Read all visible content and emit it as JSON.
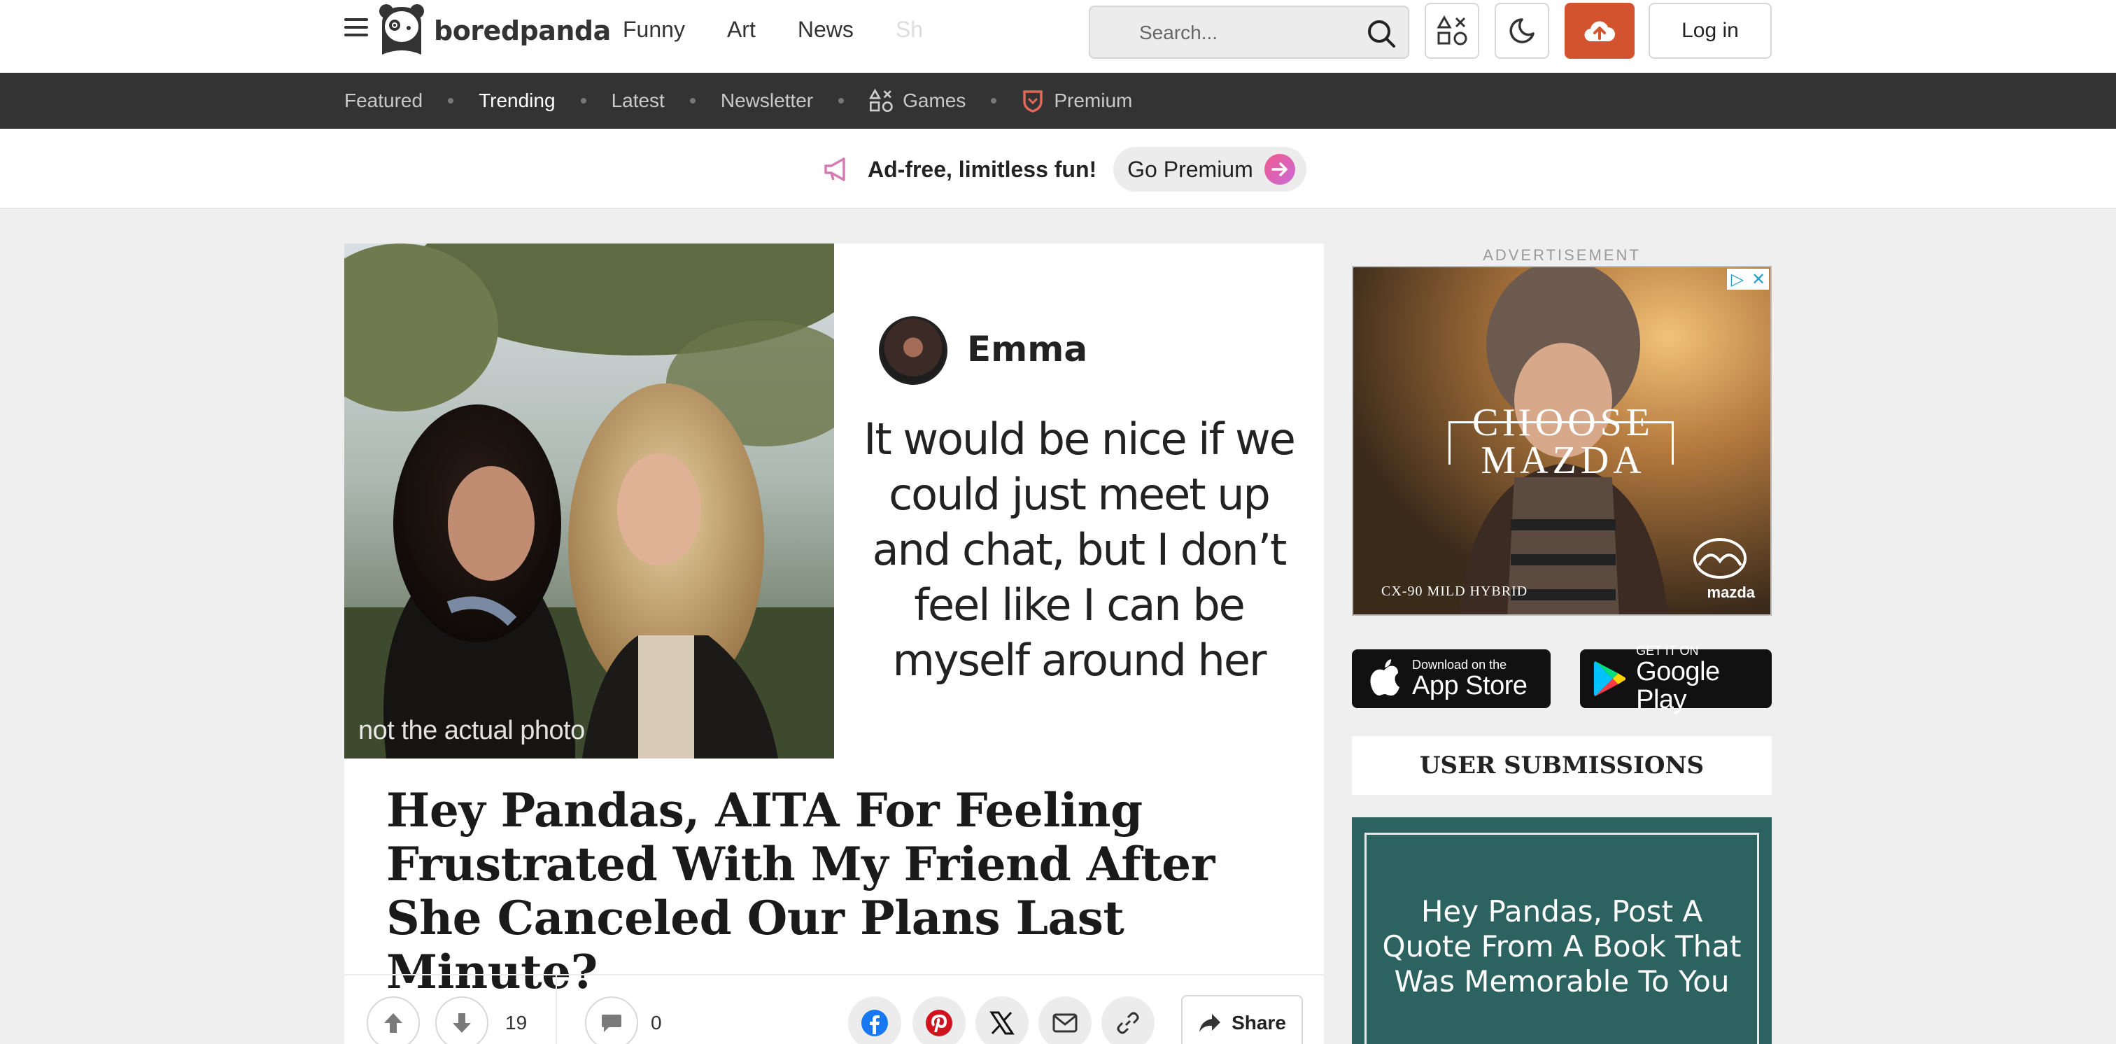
{
  "header": {
    "logo_text": "boredpanda",
    "nav": [
      "Funny",
      "Art",
      "News",
      "Sh"
    ],
    "search_placeholder": "Search...",
    "login_label": "Log in"
  },
  "subnav": {
    "items": [
      {
        "label": "Featured",
        "active": false
      },
      {
        "label": "Trending",
        "active": true
      },
      {
        "label": "Latest",
        "active": false
      },
      {
        "label": "Newsletter",
        "active": false
      },
      {
        "label": "Games",
        "active": false
      },
      {
        "label": "Premium",
        "active": false
      }
    ]
  },
  "promo": {
    "text": "Ad-free, limitless fun!",
    "button": "Go Premium"
  },
  "article": {
    "hero_caption": "not the actual photo",
    "quote_name": "Emma",
    "quote_lines": [
      "It would be nice if we",
      "could just meet up",
      "and chat, but I don’t",
      "feel like I can be",
      "myself around her"
    ],
    "title": "Hey Pandas, AITA For Feeling Frustrated With My Friend After She Canceled Our Plans Last Minute?",
    "votes": "19",
    "comments": "0",
    "share_label": "Share"
  },
  "sidebar": {
    "ad_label": "ADVERTISEMENT",
    "ad_title_1": "CHOOSE",
    "ad_title_2": "MAZDA",
    "ad_sub": "CX-90 MILD HYBRID",
    "ad_brand": "mazda",
    "appstore_small": "Download on the",
    "appstore_big": "App Store",
    "googleplay_small": "GET IT ON",
    "googleplay_big": "Google Play",
    "user_submissions": "USER SUBMISSIONS",
    "card_text": "Hey Pandas, Post A Quote From A Book That Was Memorable To You"
  },
  "colors": {
    "accent": "#d2532d",
    "subnav_bg": "#333333",
    "teal_card": "#2c625f"
  }
}
